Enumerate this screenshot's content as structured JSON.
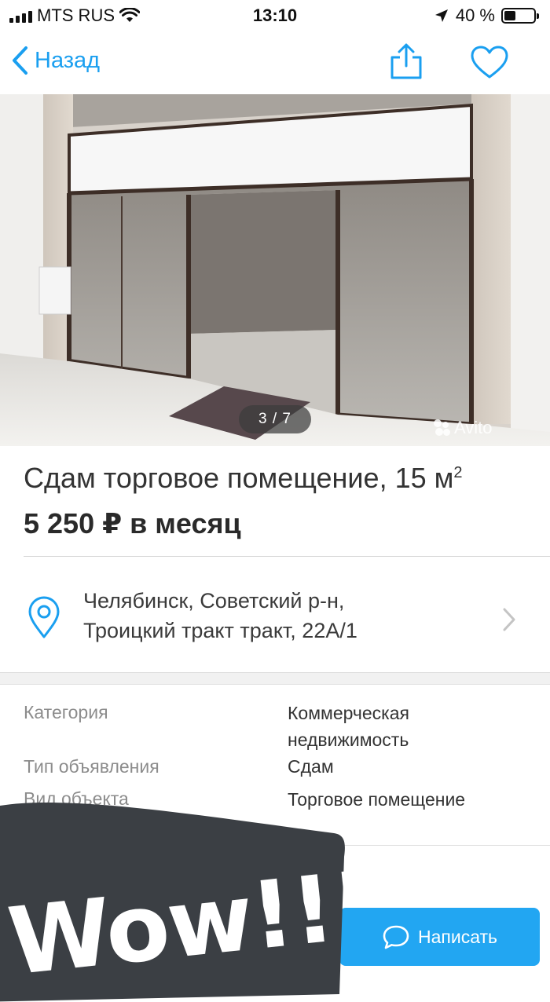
{
  "status_bar": {
    "carrier": "MTS RUS",
    "time": "13:10",
    "battery": "40 %"
  },
  "nav": {
    "back_label": "Назад",
    "share_icon": "share-icon",
    "favorite_icon": "heart-icon"
  },
  "gallery": {
    "counter": "3 / 7",
    "watermark": "Avito"
  },
  "listing": {
    "title": "Сдам торговое помещение, 15 м",
    "title_sup": "2",
    "price": "5 250 ₽ в месяц"
  },
  "address": {
    "line1": "Челябинск, Советский р-н,",
    "line2": "Троицкий тракт тракт, 22А/1"
  },
  "properties": [
    {
      "label": "Категория",
      "value_line1": "Коммерческая",
      "value_line2": "недвижимость"
    },
    {
      "label": "Тип объявления",
      "value": "Сдам"
    },
    {
      "label": "Вид объекта",
      "value": "Торговое помещение"
    }
  ],
  "actions": {
    "write_label": "Написать"
  },
  "overlay": {
    "sticker_text": "Wow!!!"
  },
  "colors": {
    "accent": "#1a9ff0",
    "button": "#22a6f2",
    "sticker": "#3b3f44"
  }
}
